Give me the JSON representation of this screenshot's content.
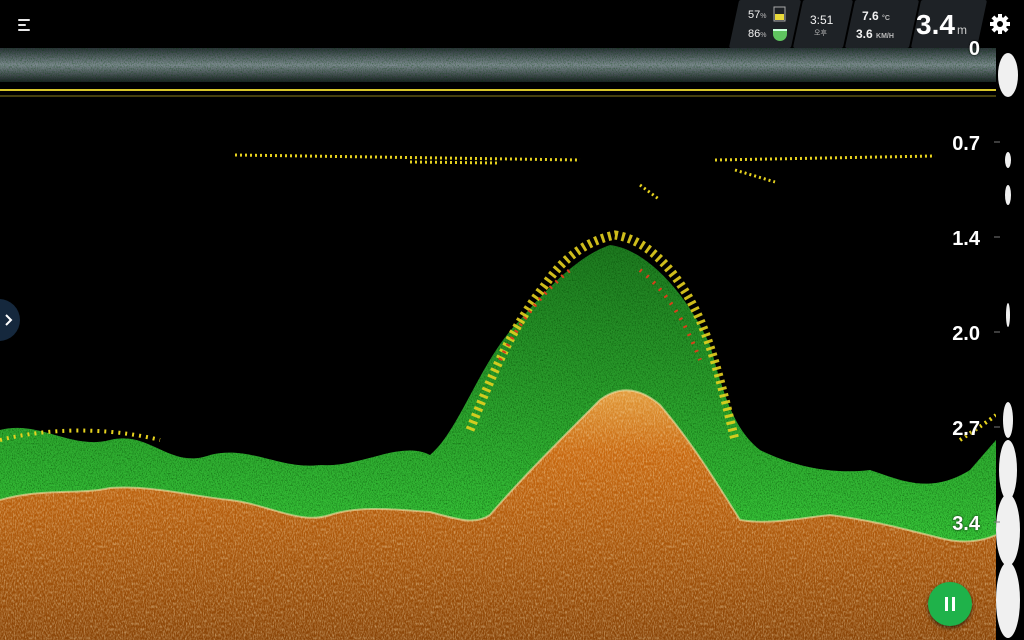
{
  "status": {
    "battery_phone_pct": "57",
    "battery_device_pct": "86",
    "pct_unit": "%",
    "time": "3:51",
    "ampm": "오후",
    "water_temp": "7.6",
    "temp_unit": "°C",
    "speed": "3.6",
    "speed_unit": "KM/H",
    "current_depth": "3.4",
    "depth_unit": "m"
  },
  "depth_scale": {
    "labels": [
      "0",
      "0.7",
      "1.4",
      "2.0",
      "2.7",
      "3.4"
    ],
    "max_depth_m": 3.4
  },
  "colors": {
    "background": "#000000",
    "bottom_orange": "#c8680f",
    "bottom_highlight": "#f2c98a",
    "weed_green": "#2fb32f",
    "return_yellow": "#e6d21e",
    "return_red": "#d8401a",
    "pause_green": "#1fb24a",
    "panel": "#1e2226"
  },
  "icons": {
    "menu": "menu-icon",
    "settings": "gear-icon",
    "side_panel": "chevron-right-icon",
    "pause": "pause-icon",
    "phone_battery": "battery-icon",
    "device_battery": "sonar-battery-icon"
  }
}
